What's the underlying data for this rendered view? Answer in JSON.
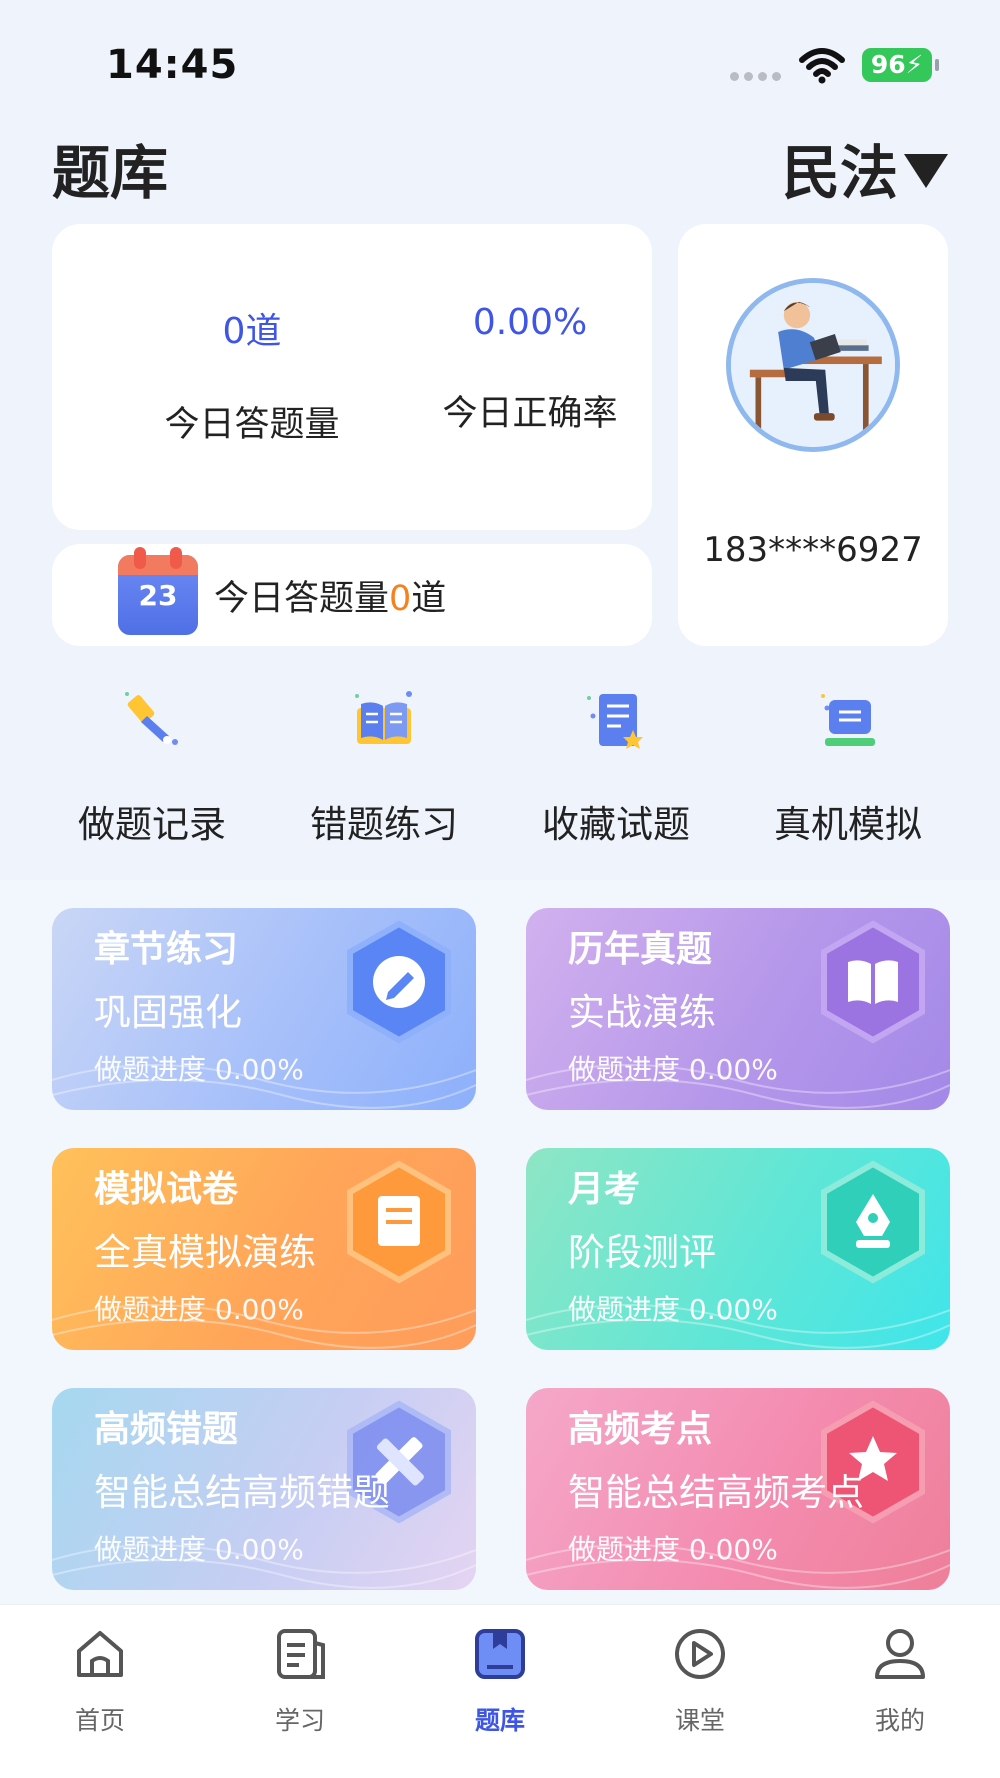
{
  "status_bar": {
    "time": "14:45",
    "battery": "96"
  },
  "header": {
    "title": "题库",
    "subject": "民法"
  },
  "stats": {
    "count_value": "0道",
    "count_label": "今日答题量",
    "rate_value": "0.00%",
    "rate_label": "今日正确率"
  },
  "today": {
    "calendar_day": "23",
    "prefix": "今日答题量",
    "count": "0",
    "suffix": "道"
  },
  "profile": {
    "phone": "183****6927"
  },
  "quick_actions": [
    {
      "label": "做题记录",
      "icon": "pen-icon"
    },
    {
      "label": "错题练习",
      "icon": "open-book-icon"
    },
    {
      "label": "收藏试题",
      "icon": "bookmark-document-icon"
    },
    {
      "label": "真机模拟",
      "icon": "computer-icon"
    }
  ],
  "modules": [
    {
      "title": "章节练习",
      "subtitle": "巩固强化",
      "progress": "做题进度 0.00%",
      "icon": "chat-pen-icon"
    },
    {
      "title": "历年真题",
      "subtitle": "实战演练",
      "progress": "做题进度 0.00%",
      "icon": "book-icon"
    },
    {
      "title": "模拟试卷",
      "subtitle": "全真模拟演练",
      "progress": "做题进度 0.00%",
      "icon": "scroll-icon"
    },
    {
      "title": "月考",
      "subtitle": "阶段测评",
      "progress": "做题进度 0.00%",
      "icon": "pen-nib-icon"
    },
    {
      "title": "高频错题",
      "subtitle": "智能总结高频错题",
      "progress": "做题进度 0.00%",
      "icon": "ruler-pencil-icon"
    },
    {
      "title": "高频考点",
      "subtitle": "智能总结高频考点",
      "progress": "做题进度 0.00%",
      "icon": "star-icon"
    }
  ],
  "tabs": [
    {
      "label": "首页",
      "icon": "home-icon"
    },
    {
      "label": "学习",
      "icon": "notes-icon"
    },
    {
      "label": "题库",
      "icon": "question-bank-icon",
      "active": true
    },
    {
      "label": "课堂",
      "icon": "play-icon"
    },
    {
      "label": "我的",
      "icon": "user-icon"
    }
  ],
  "colors": {
    "accent": "#3e55e6",
    "highlight": "#f5821f",
    "background": "#eef3fc"
  }
}
